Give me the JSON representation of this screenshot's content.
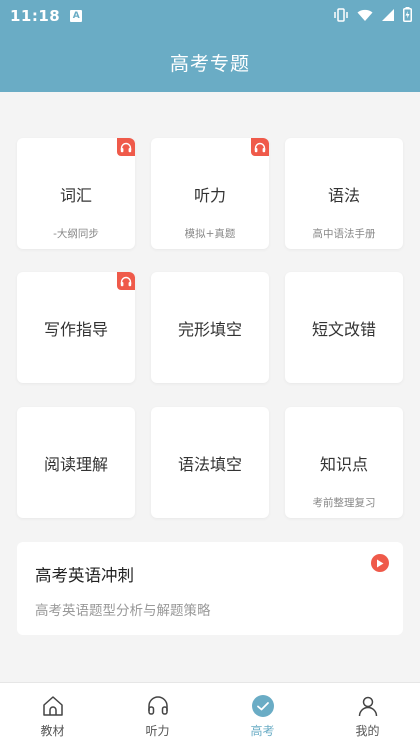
{
  "status": {
    "time": "11:18",
    "notification_glyph": "A"
  },
  "header": {
    "title": "高考专题"
  },
  "grid": [
    {
      "title": "词汇",
      "subtitle": "-大纲同步",
      "audio": true
    },
    {
      "title": "听力",
      "subtitle": "模拟+真题",
      "audio": true
    },
    {
      "title": "语法",
      "subtitle": "高中语法手册",
      "audio": false
    },
    {
      "title": "写作指导",
      "subtitle": "",
      "audio": true
    },
    {
      "title": "完形填空",
      "subtitle": "",
      "audio": false
    },
    {
      "title": "短文改错",
      "subtitle": "",
      "audio": false
    },
    {
      "title": "阅读理解",
      "subtitle": "",
      "audio": false
    },
    {
      "title": "语法填空",
      "subtitle": "",
      "audio": false
    },
    {
      "title": "知识点",
      "subtitle": "考前整理复习",
      "audio": false
    }
  ],
  "sprint": {
    "title": "高考英语冲刺",
    "description": "高考英语题型分析与解题策略"
  },
  "tabs": [
    {
      "label": "教材",
      "icon": "home-icon",
      "active": false
    },
    {
      "label": "听力",
      "icon": "headphones-icon",
      "active": false
    },
    {
      "label": "高考",
      "icon": "check-circle-icon",
      "active": true
    },
    {
      "label": "我的",
      "icon": "person-icon",
      "active": false
    }
  ],
  "colors": {
    "primary": "#6aacc5",
    "accent_red": "#ef5a4a",
    "background": "#f4f4f4"
  }
}
